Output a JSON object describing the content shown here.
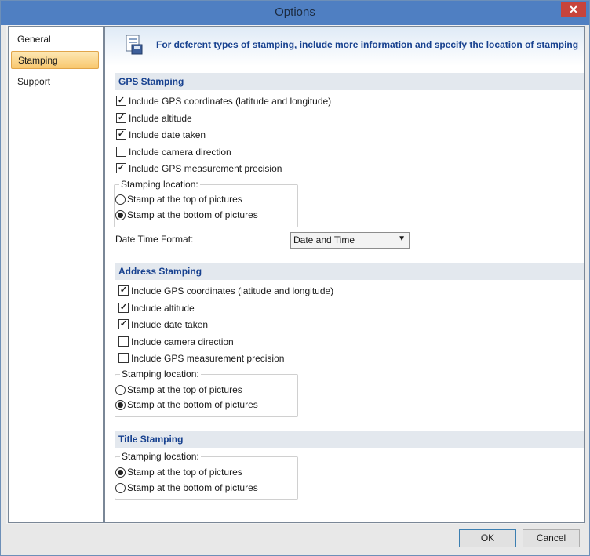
{
  "window": {
    "title": "Options",
    "close_label": "✕"
  },
  "sidebar": {
    "items": [
      {
        "label": "General"
      },
      {
        "label": "Stamping"
      },
      {
        "label": "Support"
      }
    ]
  },
  "banner": {
    "text": "For deferent types of stamping, include more information and specify the location of stamping"
  },
  "gps": {
    "header": "GPS Stamping",
    "checks": [
      {
        "label": "Include GPS coordinates (latitude and longitude)",
        "checked": true
      },
      {
        "label": "Include altitude",
        "checked": true
      },
      {
        "label": "Include date taken",
        "checked": true
      },
      {
        "label": "Include camera direction",
        "checked": false
      },
      {
        "label": "Include GPS measurement precision",
        "checked": true
      }
    ],
    "location_legend": "Stamping location:",
    "radio_top": "Stamp at the top of pictures",
    "radio_bottom": "Stamp at the bottom of pictures",
    "selected": "bottom",
    "dt_label": "Date Time Format:",
    "dt_value": "Date and Time"
  },
  "address": {
    "header": "Address Stamping",
    "checks": [
      {
        "label": "Include GPS coordinates (latitude and longitude)",
        "checked": true
      },
      {
        "label": "Include altitude",
        "checked": true
      },
      {
        "label": "Include date taken",
        "checked": true
      },
      {
        "label": "Include camera direction",
        "checked": false
      },
      {
        "label": "Include GPS measurement precision",
        "checked": false
      }
    ],
    "location_legend": "Stamping location:",
    "radio_top": "Stamp at the top of pictures",
    "radio_bottom": "Stamp at the bottom of pictures",
    "selected": "bottom"
  },
  "title_stamping": {
    "header": "Title Stamping",
    "location_legend": "Stamping location:",
    "radio_top": "Stamp at the top of pictures",
    "radio_bottom": "Stamp at the bottom of pictures",
    "selected": "top"
  },
  "footer": {
    "ok": "OK",
    "cancel": "Cancel"
  },
  "colors": {
    "titlebar": "#4f7fc2",
    "section_text": "#17418f",
    "active_item": "#f8c76d"
  }
}
